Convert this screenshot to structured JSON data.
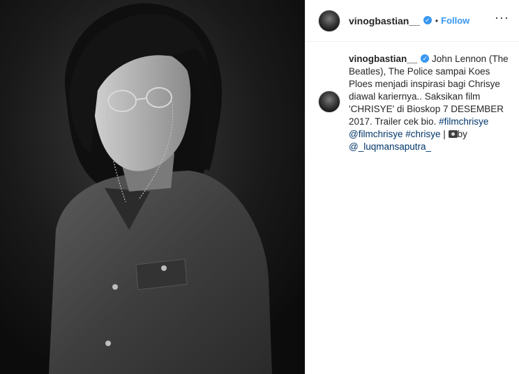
{
  "post": {
    "username": "vinogbastian__",
    "separator": "•",
    "follow_label": "Follow",
    "more_label": "···",
    "caption": {
      "text_1": "John Lennon (The Beatles), The Police sampai Koes Ploes menjadi inspirasi bagi Chrisye diawal kariernya.. Saksikan film 'CHRISYE' di Bioskop 7 DESEMBER 2017. Trailer cek bio.",
      "tag_1": "#filmchrisye",
      "mention_1": "@filmchrisye",
      "tag_2": "#chrisye",
      "pipe": "|",
      "by_text": "by",
      "mention_2": "@_luqmansaputra_"
    }
  },
  "icons": {
    "verified": "verified-badge-icon",
    "camera": "camera-icon",
    "more": "more-options-icon"
  },
  "colors": {
    "link": "#003569",
    "follow": "#3897f0",
    "text": "#262626"
  }
}
